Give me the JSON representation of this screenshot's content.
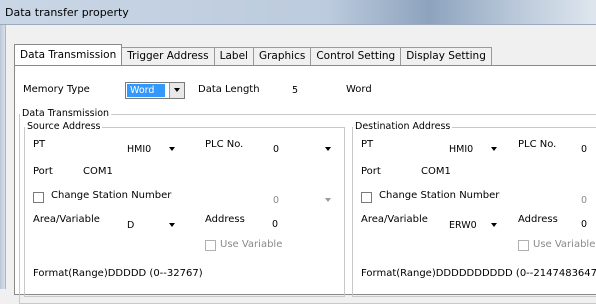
{
  "window": {
    "title": "Data transfer property"
  },
  "tabs": [
    {
      "label": "Data Transmission",
      "active": true
    },
    {
      "label": "Trigger Address"
    },
    {
      "label": "Label"
    },
    {
      "label": "Graphics"
    },
    {
      "label": "Control Setting"
    },
    {
      "label": "Display Setting"
    }
  ],
  "top": {
    "memory_type_label": "Memory Type",
    "memory_type_value": "Word",
    "data_length_label": "Data Length",
    "data_length_value": "5",
    "data_length_unit": "Word"
  },
  "data_transmission_group": "Data Transmission",
  "source": {
    "group_label": "Source Address",
    "pt_label": "PT",
    "pt_value": "HMI0",
    "plc_label": "PLC No.",
    "plc_value": "0",
    "port_label": "Port",
    "port_value": "COM1",
    "change_station_label": "Change Station Number",
    "change_station_value": "0",
    "area_label": "Area/Variable",
    "area_value": "D",
    "address_label": "Address",
    "address_value": "0",
    "use_variable_label": "Use Variable",
    "format_text": "Format(Range)DDDDD (0--32767)"
  },
  "destination": {
    "group_label": "Destination Address",
    "pt_label": "PT",
    "pt_value": "HMI0",
    "plc_label": "PLC No.",
    "plc_value": "0",
    "port_label": "Port",
    "port_value": "COM1",
    "change_station_label": "Change Station Number",
    "change_station_value": "0",
    "area_label": "Area/Variable",
    "area_value": "ERW0",
    "address_label": "Address",
    "address_value": "0",
    "use_variable_label": "Use Variable",
    "format_text": "Format(Range)DDDDDDDDDD (0--2147483647"
  }
}
